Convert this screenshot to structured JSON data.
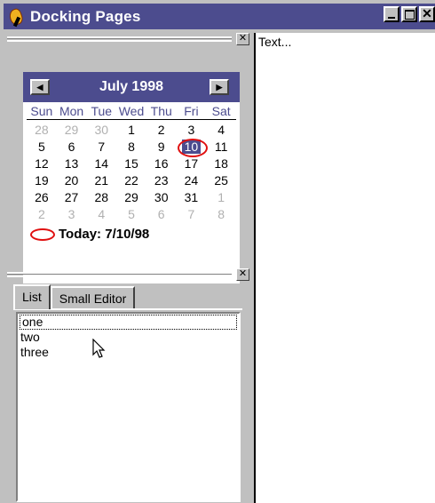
{
  "window": {
    "title": "Docking Pages"
  },
  "calendar": {
    "month_label": "July 1998",
    "days_of_week": [
      "Sun",
      "Mon",
      "Tue",
      "Wed",
      "Thu",
      "Fri",
      "Sat"
    ],
    "weeks": [
      [
        {
          "d": "28",
          "o": true
        },
        {
          "d": "29",
          "o": true
        },
        {
          "d": "30",
          "o": true
        },
        {
          "d": "1"
        },
        {
          "d": "2"
        },
        {
          "d": "3"
        },
        {
          "d": "4"
        }
      ],
      [
        {
          "d": "5"
        },
        {
          "d": "6"
        },
        {
          "d": "7"
        },
        {
          "d": "8"
        },
        {
          "d": "9"
        },
        {
          "d": "10",
          "s": true
        },
        {
          "d": "11"
        }
      ],
      [
        {
          "d": "12"
        },
        {
          "d": "13"
        },
        {
          "d": "14"
        },
        {
          "d": "15"
        },
        {
          "d": "16"
        },
        {
          "d": "17"
        },
        {
          "d": "18"
        }
      ],
      [
        {
          "d": "19"
        },
        {
          "d": "20"
        },
        {
          "d": "21"
        },
        {
          "d": "22"
        },
        {
          "d": "23"
        },
        {
          "d": "24"
        },
        {
          "d": "25"
        }
      ],
      [
        {
          "d": "26"
        },
        {
          "d": "27"
        },
        {
          "d": "28"
        },
        {
          "d": "29"
        },
        {
          "d": "30"
        },
        {
          "d": "31"
        },
        {
          "d": "1",
          "o": true
        }
      ],
      [
        {
          "d": "2",
          "o": true
        },
        {
          "d": "3",
          "o": true
        },
        {
          "d": "4",
          "o": true
        },
        {
          "d": "5",
          "o": true
        },
        {
          "d": "6",
          "o": true
        },
        {
          "d": "7",
          "o": true
        },
        {
          "d": "8",
          "o": true
        }
      ]
    ],
    "today_label": "Today: 7/10/98"
  },
  "tabs": [
    {
      "label": "List",
      "active": true
    },
    {
      "label": "Small Editor",
      "active": false
    }
  ],
  "list": {
    "items": [
      "one",
      "two",
      "three"
    ]
  },
  "editor": {
    "text": "Text..."
  },
  "colors": {
    "title_bar": "#4c4c8e",
    "today_circle": "#e01010"
  }
}
